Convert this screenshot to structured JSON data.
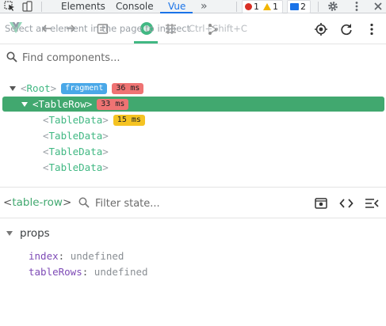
{
  "devtools": {
    "tabs": [
      {
        "label": "Elements"
      },
      {
        "label": "Console"
      },
      {
        "label": "Vue",
        "active": true
      }
    ],
    "overflow_label": "»",
    "counters": {
      "errors": "1",
      "warnings": "1",
      "messages": "2"
    },
    "icons": [
      "inspect-cursor-icon",
      "device-toolbar-icon",
      "settings-gear-icon",
      "more-vert-icon",
      "close-icon"
    ]
  },
  "vue_toolbar": {
    "inspect_hint": "Select an element in the page to inspect",
    "inspect_shortcut": "Ctrl+Shift+C",
    "icons": [
      "vue-logo-icon",
      "back-arrow-icon",
      "forward-arrow-icon",
      "component-icon",
      "timeline-icon",
      "grid-icon",
      "route-icon",
      "locate-icon",
      "refresh-icon",
      "more-vert-icon"
    ]
  },
  "search": {
    "placeholder": "Find components..."
  },
  "tree": {
    "root": {
      "tag": "Root",
      "badge": "fragment",
      "time": "36 ms"
    },
    "selected": {
      "tag": "TableRow",
      "time": "33 ms"
    },
    "children": [
      {
        "tag": "TableData",
        "time": "15 ms"
      },
      {
        "tag": "TableData"
      },
      {
        "tag": "TableData"
      },
      {
        "tag": "TableData"
      }
    ]
  },
  "inspector": {
    "component_name": "table-row",
    "filter_placeholder": "Filter state...",
    "section": "props",
    "props": [
      {
        "key": "index",
        "value": "undefined"
      },
      {
        "key": "tableRows",
        "value": "undefined"
      }
    ]
  },
  "colors": {
    "vue_green": "#41b883",
    "selected_row": "#41a86f",
    "devtools_blue": "#1a73e8"
  }
}
